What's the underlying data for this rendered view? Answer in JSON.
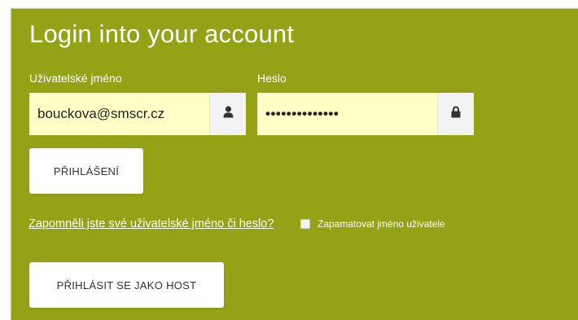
{
  "login": {
    "title": "Login into your account",
    "username_label": "Uživatelské jméno",
    "password_label": "Heslo",
    "username_value": "bouckova@smscr.cz",
    "password_value": "••••••••••••••",
    "username_icon": "user-icon",
    "password_icon": "lock-icon",
    "login_button": "PŘIHLÁŠENÍ",
    "forgot_link": "Zapomněli jste své uživatelské jméno či heslo?",
    "remember_label": "Zapamatovat jméno uživatele",
    "remember_checked": false,
    "guest_button": "PŘIHLÁSIT SE JAKO HOST"
  },
  "colors": {
    "panel_background": "#94a315",
    "input_background": "#ffffc6",
    "text_light": "#ffffff"
  }
}
